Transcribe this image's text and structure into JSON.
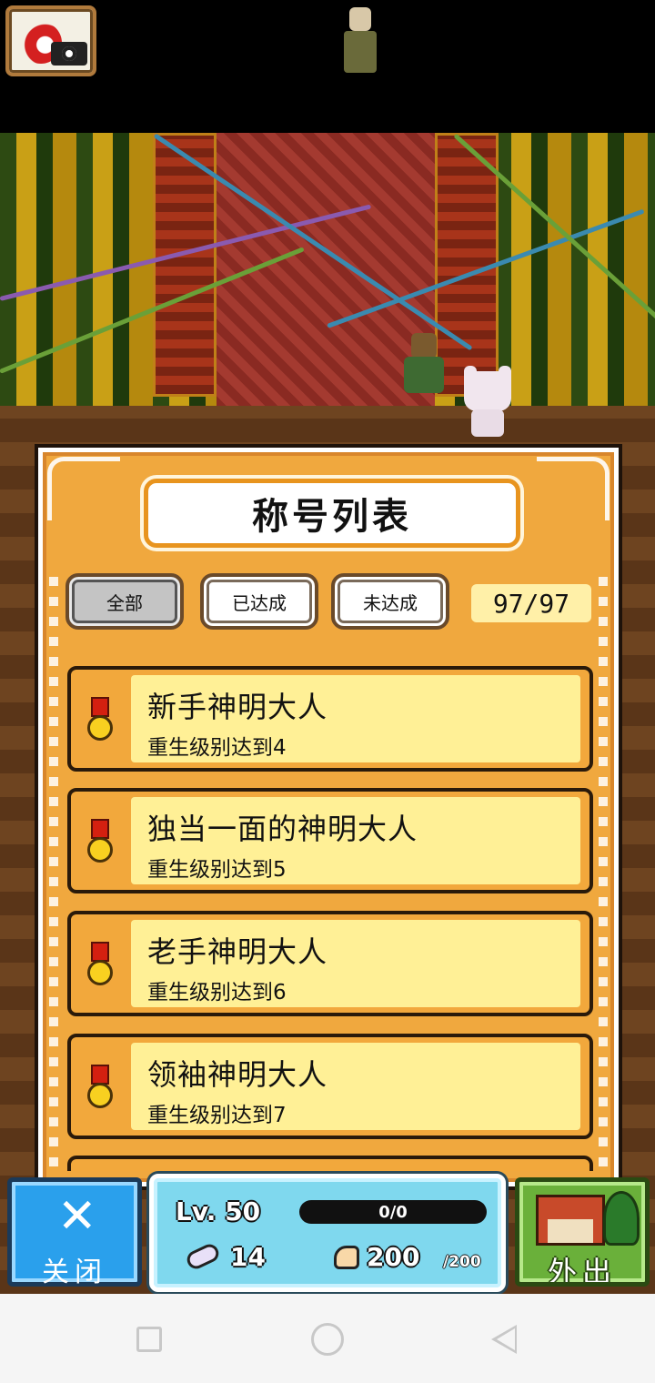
{
  "topbar": {
    "camera_icon": "camera-icon",
    "character_icon": "monk-character-icon"
  },
  "panel": {
    "title": "称号列表",
    "tabs": [
      {
        "label": "全部",
        "active": true
      },
      {
        "label": "已达成",
        "active": false
      },
      {
        "label": "未达成",
        "active": false
      }
    ],
    "count": "97/97",
    "items": [
      {
        "name": "新手神明大人",
        "desc": "重生级别达到4",
        "icon": "medal-icon"
      },
      {
        "name": "独当一面的神明大人",
        "desc": "重生级别达到5",
        "icon": "medal-icon"
      },
      {
        "name": "老手神明大人",
        "desc": "重生级别达到6",
        "icon": "medal-icon"
      },
      {
        "name": "领袖神明大人",
        "desc": "重生级别达到7",
        "icon": "medal-icon"
      }
    ]
  },
  "hud": {
    "close_label": "关闭",
    "close_icon": "x-icon",
    "level": "Lv. 50",
    "xp": "0/0",
    "mice": "14",
    "power": "200",
    "power_max": "/200",
    "out_label": "外出"
  },
  "colors": {
    "panel_bg": "#f0a83e",
    "item_inner": "#fff096",
    "close_btn": "#2aa0ec",
    "out_btn": "#6ab03a",
    "stats_bg": "#7fd8ee"
  }
}
